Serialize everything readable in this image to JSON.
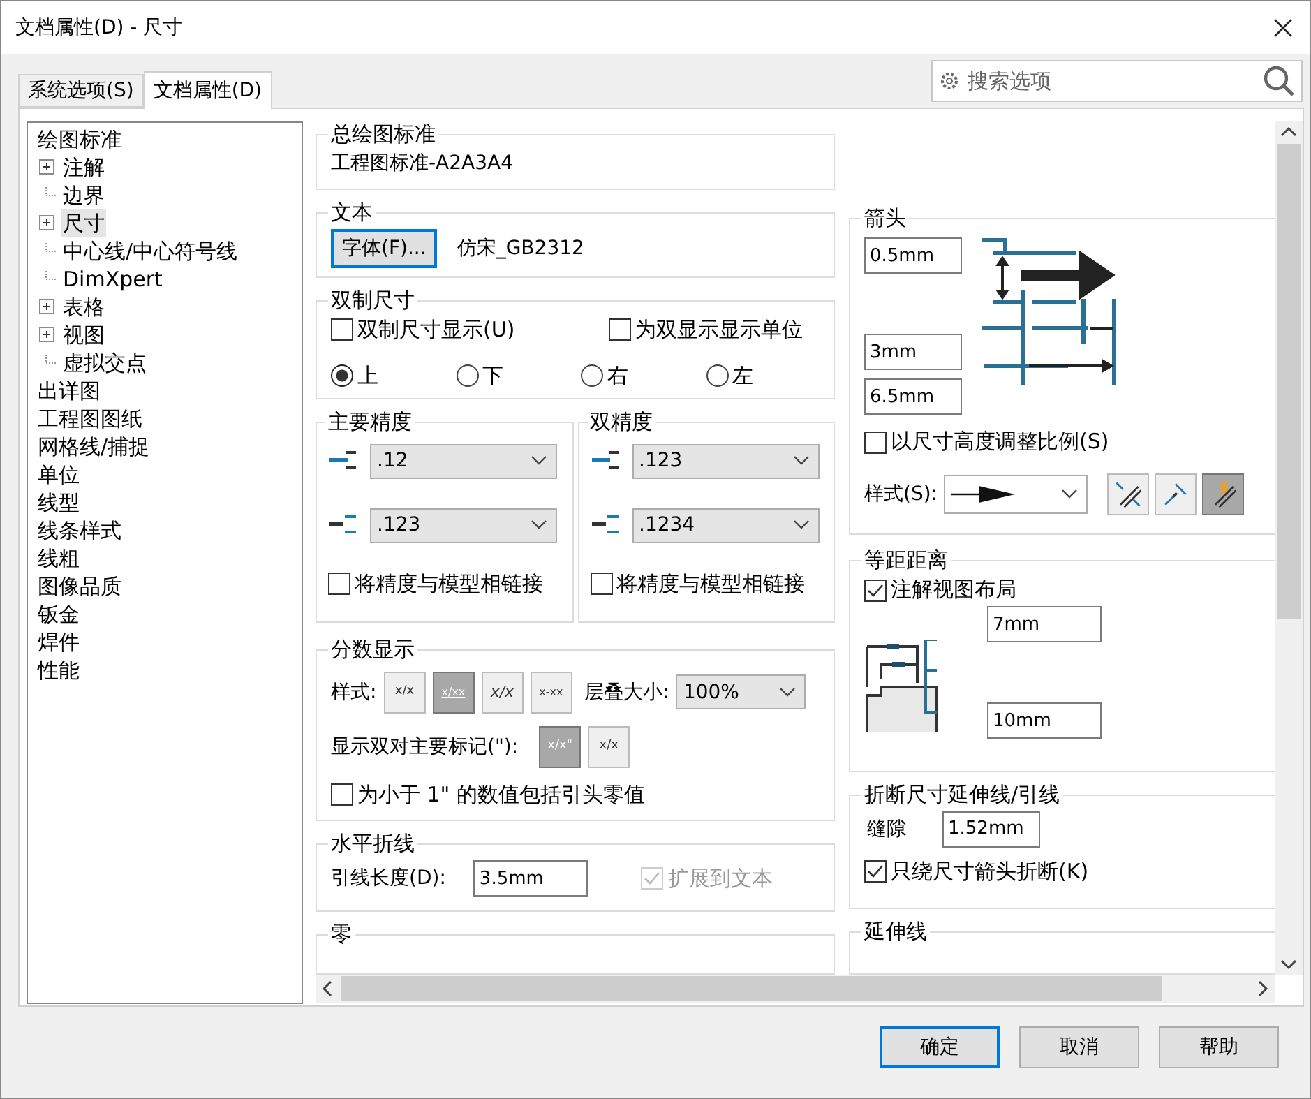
{
  "window": {
    "title": "文档属性(D) - 尺寸"
  },
  "tabs": [
    {
      "label": "系统选项(S)",
      "selected": false
    },
    {
      "label": "文档属性(D)",
      "selected": true
    }
  ],
  "search": {
    "placeholder": "搜索选项"
  },
  "tree": [
    {
      "label": "绘图标准",
      "selected": false,
      "children": [
        {
          "label": "注解",
          "selected": false,
          "expanded": false
        },
        {
          "label": "边界",
          "selected": false
        },
        {
          "label": "尺寸",
          "selected": true,
          "expanded": false
        },
        {
          "label": "中心线/中心符号线",
          "selected": false
        },
        {
          "label": "DimXpert",
          "selected": false
        },
        {
          "label": "表格",
          "selected": false,
          "expanded": false
        },
        {
          "label": "视图",
          "selected": false,
          "expanded": false
        },
        {
          "label": "虚拟交点",
          "selected": false
        }
      ]
    },
    {
      "label": "出详图",
      "selected": false
    },
    {
      "label": "工程图图纸",
      "selected": false
    },
    {
      "label": "网格线/捕捉",
      "selected": false
    },
    {
      "label": "单位",
      "selected": false
    },
    {
      "label": "线型",
      "selected": false
    },
    {
      "label": "线条样式",
      "selected": false
    },
    {
      "label": "线粗",
      "selected": false
    },
    {
      "label": "图像品质",
      "selected": false
    },
    {
      "label": "钣金",
      "selected": false
    },
    {
      "label": "焊件",
      "selected": false
    },
    {
      "label": "性能",
      "selected": false
    }
  ],
  "general_standard": {
    "title": "总绘图标准",
    "value": "工程图标准-A2A3A4"
  },
  "text": {
    "title": "文本",
    "font_button": "字体(F)...",
    "font_value": "仿宋_GB2312"
  },
  "dual": {
    "title": "双制尺寸",
    "checkboxes": [
      {
        "label": "双制尺寸显示(U)",
        "checked": false
      },
      {
        "label": "为双显示显示单位",
        "checked": false
      }
    ],
    "radios": [
      {
        "label": "上",
        "selected": true
      },
      {
        "label": "下",
        "selected": false
      },
      {
        "label": "右",
        "selected": false
      },
      {
        "label": "左",
        "selected": false
      }
    ]
  },
  "precision": [
    {
      "title": "主要精度",
      "rows": [
        {
          "kind": "value",
          "value": ".12"
        },
        {
          "kind": "tolerance",
          "value": ".123"
        }
      ],
      "link": {
        "label": "将精度与模型相链接",
        "checked": false
      }
    },
    {
      "title": "双精度",
      "rows": [
        {
          "kind": "value",
          "value": ".123"
        },
        {
          "kind": "tolerance",
          "value": ".1234"
        }
      ],
      "link": {
        "label": "将精度与模型相链接",
        "checked": false
      }
    }
  ],
  "fraction": {
    "title": "分数显示",
    "style_label": "样式:",
    "styles": [
      {
        "kind": "inline",
        "label": "x/x",
        "selected": false
      },
      {
        "kind": "stacked",
        "label": "x/xx",
        "selected": true
      },
      {
        "kind": "diagonal",
        "label": "x/x",
        "selected": false
      },
      {
        "kind": "dash",
        "label": "x-xx",
        "selected": false
      }
    ],
    "stack_label": "层叠大小:",
    "stack_value": "100%",
    "dual_label": "显示双对主要标记(\"):",
    "dual_styles": [
      {
        "kind": "inline",
        "label": "x/x\"",
        "selected": true
      },
      {
        "kind": "inline",
        "label": "x/x",
        "selected": false
      }
    ],
    "leading_zero": {
      "label": "为小于 1\" 的数值包括引头零值",
      "checked": false
    }
  },
  "horizontal": {
    "title": "水平折线",
    "label": "引线长度(D):",
    "value": "3.5mm",
    "extend": {
      "label": "扩展到文本",
      "checked": true,
      "disabled": true
    }
  },
  "zero": {
    "title": "零"
  },
  "arrows": {
    "title": "箭头",
    "fields": [
      "0.5mm",
      "3mm",
      "6.5mm"
    ],
    "scale": {
      "label": "以尺寸高度调整比例(S)",
      "checked": false
    },
    "style_label": "样式(S):",
    "tools": [
      {
        "kind": "inside",
        "selected": false
      },
      {
        "kind": "outside",
        "selected": false
      },
      {
        "kind": "smart",
        "selected": true
      }
    ]
  },
  "offset": {
    "title": "等距距离",
    "layout": {
      "label": "注解视图布局",
      "checked": true
    },
    "fields": [
      "7mm",
      "10mm"
    ]
  },
  "break": {
    "title": "折断尺寸延伸线/引线",
    "gap_label": "缝隙",
    "gap_value": "1.52mm",
    "only": {
      "label": "只绕尺寸箭头折断(K)",
      "checked": true
    }
  },
  "extension": {
    "title": "延伸线"
  },
  "buttons": [
    {
      "label": "确定",
      "default": true
    },
    {
      "label": "取消",
      "default": false
    },
    {
      "label": "帮助",
      "default": false
    }
  ]
}
